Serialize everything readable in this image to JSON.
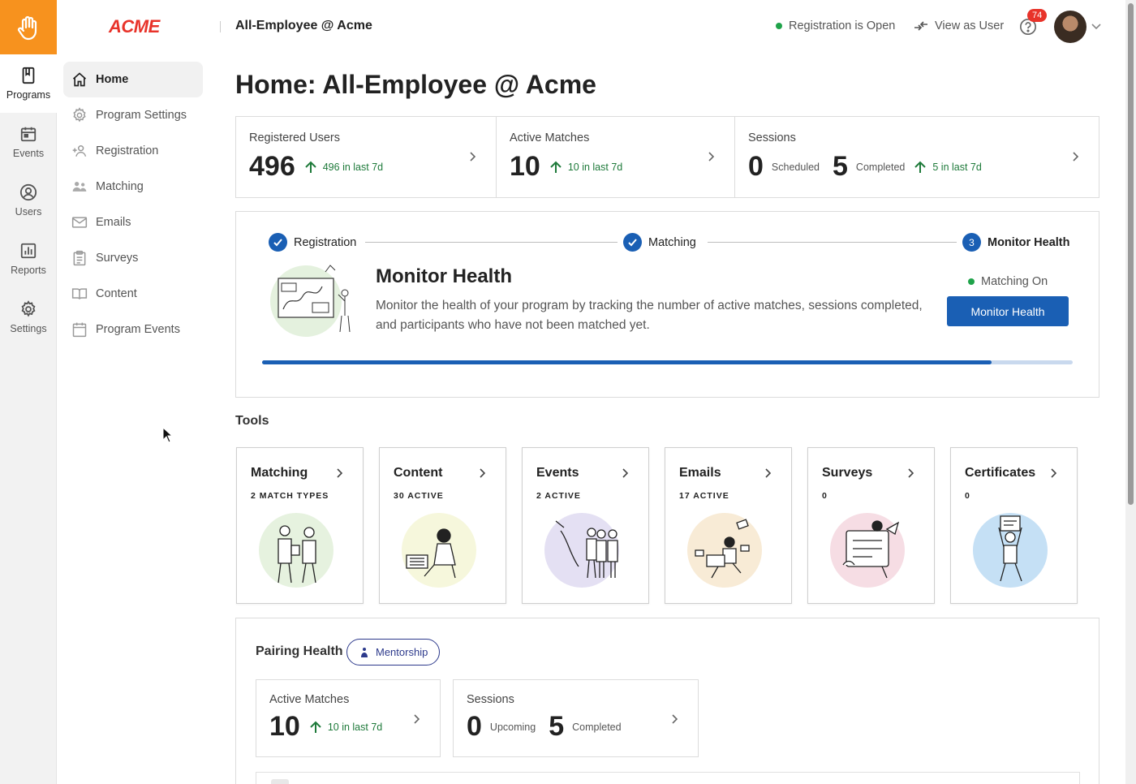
{
  "colors": {
    "accent": "#1a5fb4",
    "brand_orange": "#f7921e",
    "brand_red": "#e8332a",
    "success": "#1fa34a",
    "trend_green": "#1e7a3a"
  },
  "rail": {
    "logo_icon": "hand-wave-icon",
    "items": [
      {
        "label": "Programs",
        "icon": "book-icon",
        "active": true
      },
      {
        "label": "Events",
        "icon": "calendar-icon"
      },
      {
        "label": "Users",
        "icon": "user-circle-icon"
      },
      {
        "label": "Reports",
        "icon": "bar-chart-icon"
      },
      {
        "label": "Settings",
        "icon": "gear-icon"
      }
    ]
  },
  "sidenav": {
    "brand": "ACME",
    "items": [
      {
        "label": "Home",
        "icon": "home-icon",
        "active": true
      },
      {
        "label": "Program Settings",
        "icon": "gear-icon"
      },
      {
        "label": "Registration",
        "icon": "add-user-icon"
      },
      {
        "label": "Matching",
        "icon": "users-icon"
      },
      {
        "label": "Emails",
        "icon": "mail-icon"
      },
      {
        "label": "Surveys",
        "icon": "clipboard-icon"
      },
      {
        "label": "Content",
        "icon": "book-open-icon"
      },
      {
        "label": "Program Events",
        "icon": "calendar-icon"
      }
    ]
  },
  "header": {
    "title": "All-Employee @ Acme",
    "registration_status": "Registration is Open",
    "view_as_user": "View as User",
    "notification_count": "74"
  },
  "page": {
    "title": "Home: All-Employee @ Acme"
  },
  "stats": {
    "registered": {
      "label": "Registered Users",
      "value": "496",
      "trend": "496 in last 7d"
    },
    "active_matches": {
      "label": "Active Matches",
      "value": "10",
      "trend": "10 in last 7d"
    },
    "sessions": {
      "label": "Sessions",
      "scheduled_value": "0",
      "scheduled_label": "Scheduled",
      "completed_value": "5",
      "completed_label": "Completed",
      "trend": "5 in last 7d"
    }
  },
  "progress": {
    "steps": [
      {
        "label": "Registration",
        "done": true
      },
      {
        "label": "Matching",
        "done": true
      },
      {
        "label": "Monitor Health",
        "number": "3",
        "current": true
      }
    ],
    "title": "Monitor Health",
    "description": "Monitor the health of your program by tracking the number of active matches, sessions completed, and participants who have not been matched yet.",
    "matching_status": "Matching On",
    "button": "Monitor Health",
    "fraction": 0.9
  },
  "tools": {
    "title": "Tools",
    "items": [
      {
        "name": "Matching",
        "sub": "2 MATCH TYPES",
        "art_bg": "#e6f2df"
      },
      {
        "name": "Content",
        "sub": "30 ACTIVE",
        "art_bg": "#f6f7dc"
      },
      {
        "name": "Events",
        "sub": "2 ACTIVE",
        "art_bg": "#e4e0f3"
      },
      {
        "name": "Emails",
        "sub": "17 ACTIVE",
        "art_bg": "#f8ebd6"
      },
      {
        "name": "Surveys",
        "sub": "0",
        "art_bg": "#f6dde4"
      },
      {
        "name": "Certificates",
        "sub": "0",
        "art_bg": "#c5e0f5"
      }
    ]
  },
  "pairing": {
    "title": "Pairing Health",
    "pill": "Mentorship",
    "active_matches": {
      "label": "Active Matches",
      "value": "10",
      "trend": "10 in last 7d"
    },
    "sessions": {
      "label": "Sessions",
      "upcoming_value": "0",
      "upcoming_label": "Upcoming",
      "completed_value": "5",
      "completed_label": "Completed"
    }
  }
}
